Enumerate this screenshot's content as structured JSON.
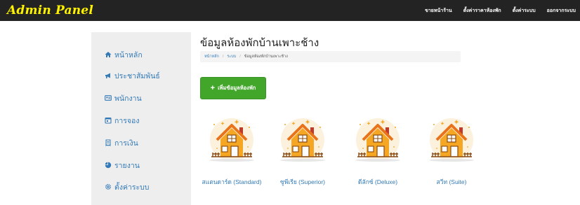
{
  "navbar": {
    "brand": "Admin Panel",
    "links": [
      "ขายหน้าร้าน",
      "ตั้งค่าราคาห้องพัก",
      "ตั้งค่าระบบ",
      "ออกจากระบบ"
    ]
  },
  "sidebar": {
    "items": [
      {
        "label": "หน้าหลัก",
        "icon": "home-icon"
      },
      {
        "label": "ประชาสัมพันธ์",
        "icon": "bullhorn-icon"
      },
      {
        "label": "พนักงาน",
        "icon": "id-card-icon"
      },
      {
        "label": "การจอง",
        "icon": "calendar-icon"
      },
      {
        "label": "การเงิน",
        "icon": "receipt-icon"
      },
      {
        "label": "รายงาน",
        "icon": "chart-icon"
      },
      {
        "label": "ตั้งค่าระบบ",
        "icon": "gear-icon"
      }
    ]
  },
  "main": {
    "title": "ข้อมูลห้องพักบ้านเพาะช้าง",
    "breadcrumb": [
      "หน้าหลัก",
      "ระบบ",
      "ข้อมูลห้องพักบ้านเพาะช้าง"
    ],
    "add_button": "เพิ่มข้อมูลห้องพัก",
    "rooms": [
      {
        "name": "สแตนดาร์ด (Standard)"
      },
      {
        "name": "ซูพีเรีย (Superior)"
      },
      {
        "name": "ดีลักซ์ (Deluxe)"
      },
      {
        "name": "สวีท (Suite)"
      }
    ]
  },
  "colors": {
    "navbar": "#232323",
    "brand": "#fff200",
    "sidebar_bg": "#eeeeee",
    "link": "#337ab7",
    "add_button": "#41a62a",
    "house_body": "#f5a623",
    "house_bg": "#fbf1dd"
  }
}
